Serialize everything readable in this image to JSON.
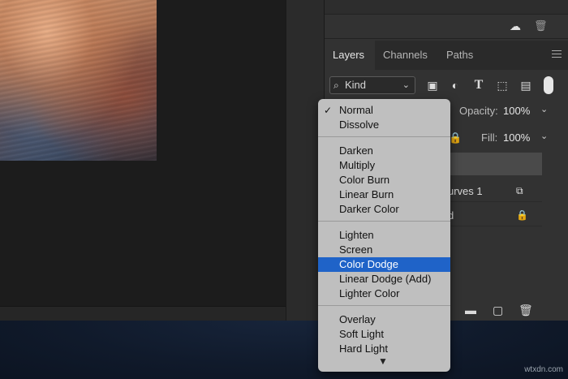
{
  "layers_panel": {
    "tabs": [
      {
        "label": "Layers",
        "active": true
      },
      {
        "label": "Channels",
        "active": false
      },
      {
        "label": "Paths",
        "active": false
      }
    ],
    "filter_kind": "Kind",
    "opacity_label": "Opacity:",
    "opacity_value": "100%",
    "fill_label": "Fill:",
    "fill_value": "100%",
    "layers": [
      {
        "name": "",
        "selected": true
      },
      {
        "name": "urves 1",
        "selected": false
      },
      {
        "name": "d",
        "selected": false
      }
    ],
    "filter_icons": [
      "image-filter-icon",
      "adjustment-filter-icon",
      "type-filter-icon",
      "shape-filter-icon",
      "smart-object-filter-icon"
    ],
    "bottom_icons": [
      "group-folder-icon",
      "new-layer-icon",
      "trash-icon"
    ]
  },
  "blend_menu": {
    "groups": [
      [
        "Normal",
        "Dissolve"
      ],
      [
        "Darken",
        "Multiply",
        "Color Burn",
        "Linear Burn",
        "Darker Color"
      ],
      [
        "Lighten",
        "Screen",
        "Color Dodge",
        "Linear Dodge (Add)",
        "Lighter Color"
      ],
      [
        "Overlay",
        "Soft Light",
        "Hard Light"
      ]
    ],
    "checked": "Normal",
    "highlighted": "Color Dodge",
    "highlight_color": "#1f63c8"
  },
  "watermark": "wtxdn.com"
}
